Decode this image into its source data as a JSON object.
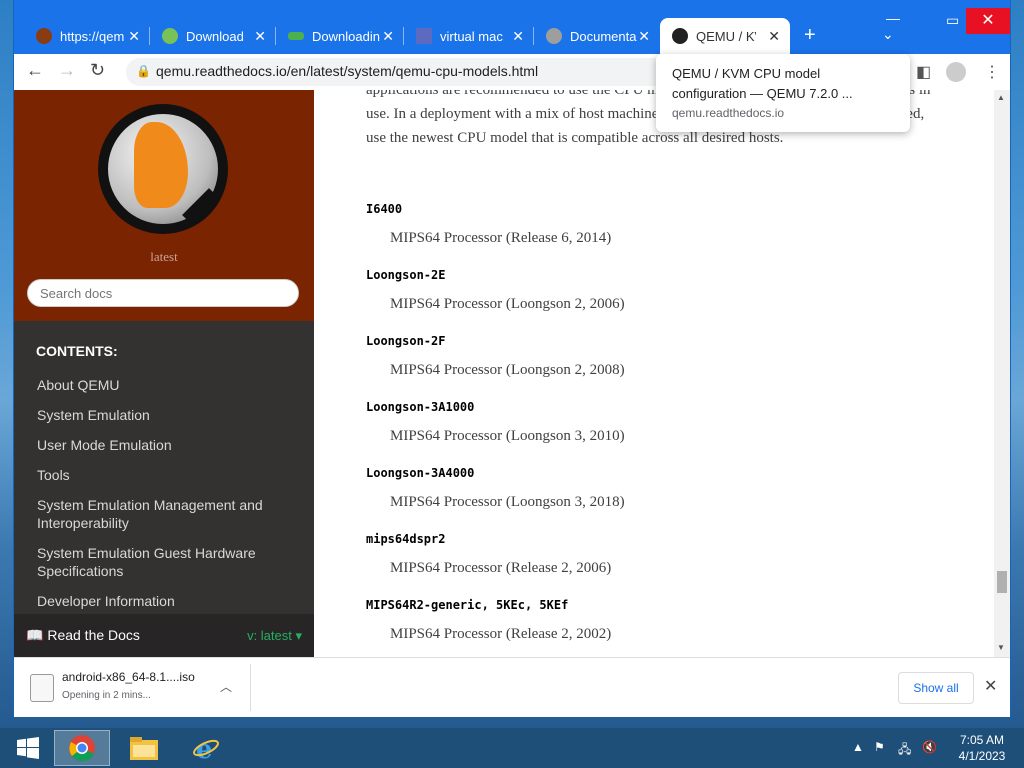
{
  "browser": {
    "tabs": [
      {
        "title": "https://qem",
        "favicon_color": "#8a3b12"
      },
      {
        "title": "Download",
        "favicon_color": "#78c257"
      },
      {
        "title": "Downloadin",
        "favicon_color": "#4caf50"
      },
      {
        "title": "virtual mac",
        "favicon_color": "#5c6bc0"
      },
      {
        "title": "Documenta",
        "favicon_color": "#9e9e9e"
      },
      {
        "title": "QEMU / KVI",
        "favicon_color": "#222222"
      }
    ],
    "new_tab": "+",
    "address": "qemu.readthedocs.io/en/latest/system/qemu-cpu-models.html"
  },
  "tooltip": {
    "title": "QEMU / KVM CPU model configuration — QEMU 7.2.0 ...",
    "domain": "qemu.readthedocs.io"
  },
  "sidebar": {
    "version": "latest",
    "search_placeholder": "Search docs",
    "contents_heading": "CONTENTS:",
    "nav_items": [
      "About QEMU",
      "System Emulation",
      "User Mode Emulation",
      "Tools",
      "System Emulation Management and Interoperability",
      "System Emulation Guest Hardware Specifications",
      "Developer Information"
    ],
    "rtd_label": "Read the Docs",
    "rtd_version": "v: latest"
  },
  "content": {
    "intro": "applications are recommended to use the CPU model that is compatible with the host CPUs in use. In a deployment with a mix of host machines, if live migration compatibility is required, use the newest CPU model that is compatible across all desired hosts.",
    "cpus": [
      {
        "name": "I6400",
        "desc": "MIPS64 Processor (Release 6, 2014)"
      },
      {
        "name": "Loongson-2E",
        "desc": "MIPS64 Processor (Loongson 2, 2006)"
      },
      {
        "name": "Loongson-2F",
        "desc": "MIPS64 Processor (Loongson 2, 2008)"
      },
      {
        "name": "Loongson-3A1000",
        "desc": "MIPS64 Processor (Loongson 3, 2010)"
      },
      {
        "name": "Loongson-3A4000",
        "desc": "MIPS64 Processor (Loongson 3, 2018)"
      },
      {
        "name": "mips64dspr2",
        "desc": "MIPS64 Processor (Release 2, 2006)"
      },
      {
        "name": "MIPS64R2-generic, 5KEc, 5KEf",
        "desc": "MIPS64 Processor (Release 2, 2002)"
      }
    ]
  },
  "download": {
    "filename": "android-x86_64-8.1....iso",
    "status": "Opening in 2 mins...",
    "show_all": "Show all"
  },
  "taskbar": {
    "time": "7:05 AM",
    "date": "4/1/2023"
  }
}
